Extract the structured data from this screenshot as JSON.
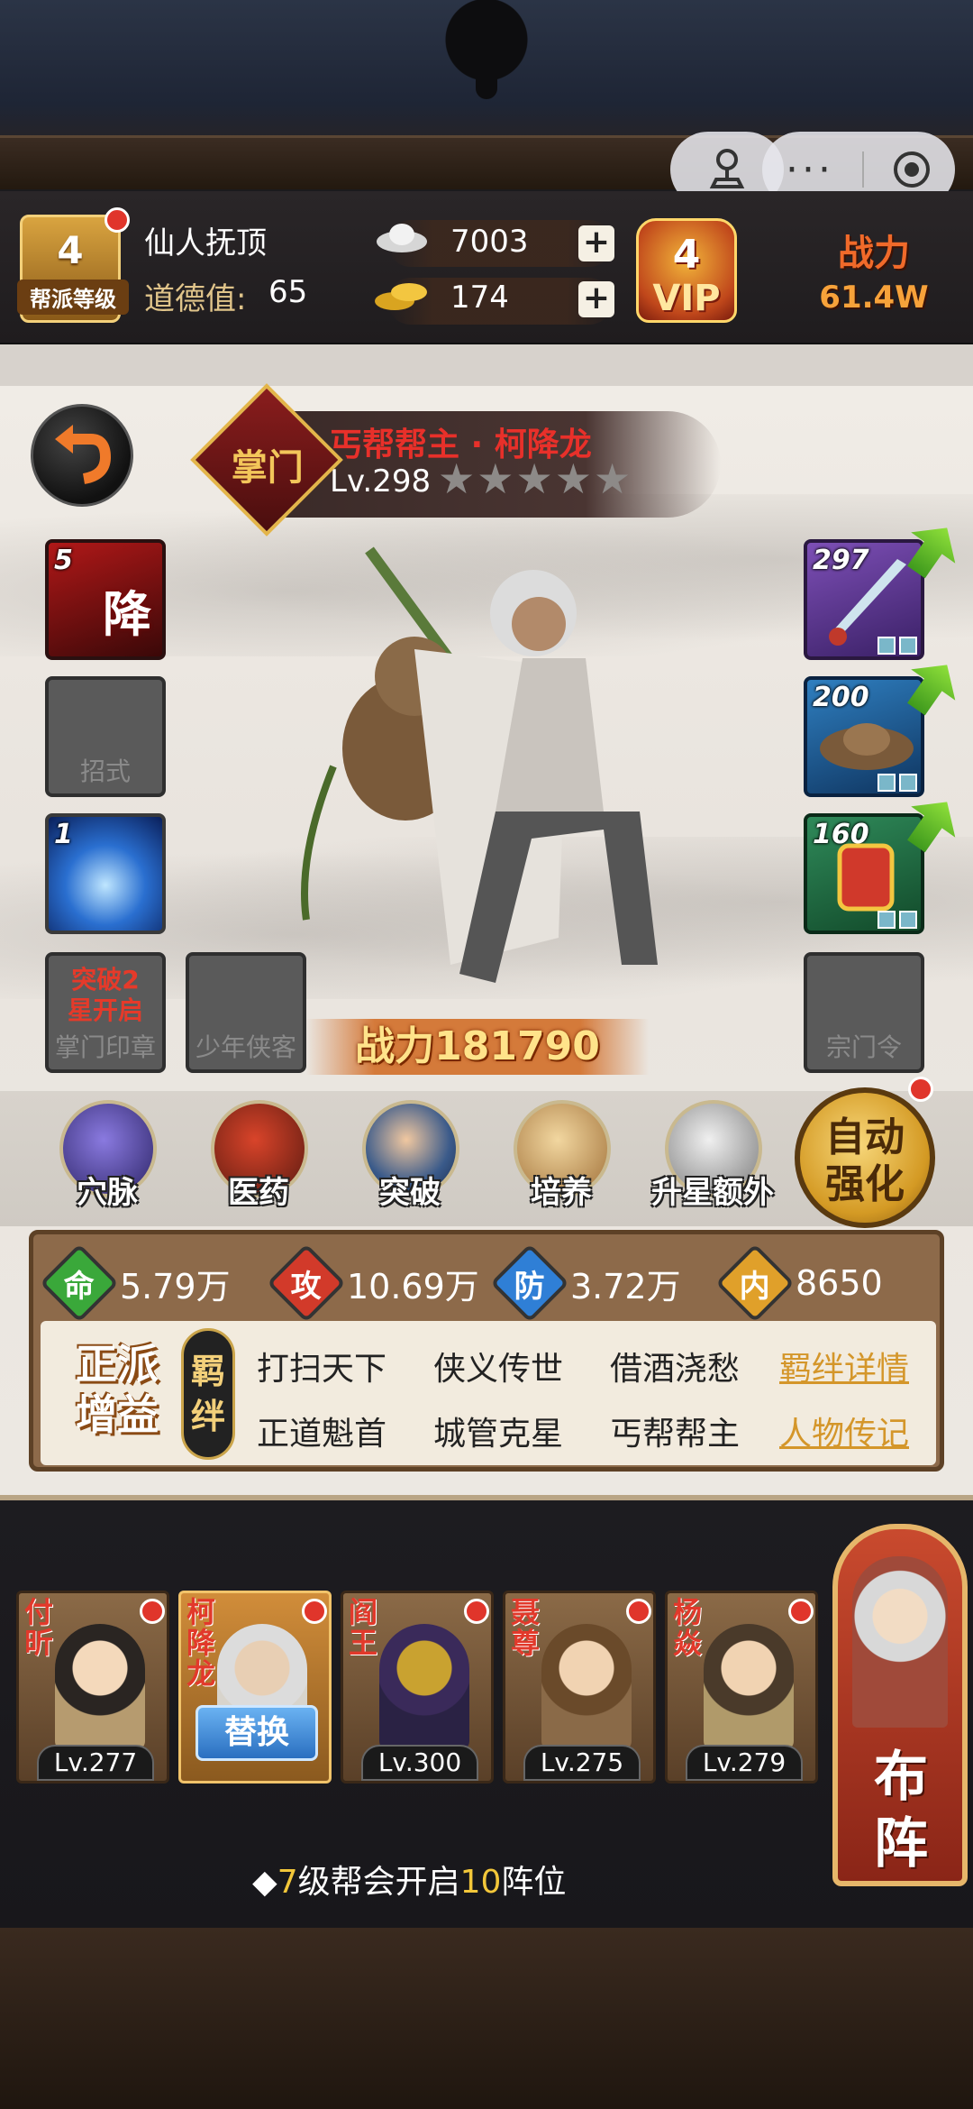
{
  "top": {
    "guild_level": "4",
    "guild_level_caption": "帮派等级",
    "player_name": "仙人抚顶",
    "morality_label": "道德值:",
    "morality_value": "65",
    "silver": "7003",
    "gold": "174",
    "vip_level": "4",
    "vip_text": "VIP",
    "power_label": "战力",
    "power_value": "61.4W",
    "menu_dots": "···"
  },
  "character": {
    "title": "丐帮帮主 · 柯降龙",
    "emblem": "掌门",
    "level": "Lv.298",
    "stars": 5,
    "power_text": "战力181790"
  },
  "left_slots": [
    {
      "num": "5",
      "glyph": "降",
      "label": ""
    },
    {
      "num": "",
      "glyph": "",
      "label": "招式"
    },
    {
      "num": "1",
      "glyph": "",
      "label": ""
    }
  ],
  "bottom_left_slots": [
    {
      "lock_text": "突破2\n星开启",
      "label": "掌门印章"
    },
    {
      "lock_text": "",
      "label": "少年侠客"
    }
  ],
  "right_slots": [
    {
      "num": "297"
    },
    {
      "num": "200"
    },
    {
      "num": "160"
    },
    {
      "label": "宗门令"
    }
  ],
  "skills": [
    {
      "label": "穴脉"
    },
    {
      "label": "医药"
    },
    {
      "label": "突破"
    },
    {
      "label": "培养"
    },
    {
      "label": "升星额外"
    }
  ],
  "auto_button": "自动\n强化",
  "stats": {
    "hp_icon": "命",
    "hp": "5.79万",
    "atk_icon": "攻",
    "atk": "10.69万",
    "def_icon": "防",
    "def": "3.72万",
    "inner_icon": "内",
    "inner": "8650"
  },
  "faction_bonus": "正派\n增益",
  "bond_tag": "羁\n绊",
  "bonds": [
    "打扫天下",
    "侠义传世",
    "借酒浇愁",
    "正道魁首",
    "城管克星",
    "丐帮帮主"
  ],
  "links": {
    "bond_detail": "羁绊详情",
    "biography": "人物传记"
  },
  "team": [
    {
      "name": "付昕",
      "level": "Lv.277"
    },
    {
      "name": "柯降龙",
      "level": "",
      "swap": "替换"
    },
    {
      "name": "阎王",
      "level": "Lv.300"
    },
    {
      "name": "聂尊",
      "level": "Lv.275"
    },
    {
      "name": "杨焱",
      "level": "Lv.279"
    }
  ],
  "formation_button": "布\n阵",
  "tip": {
    "prefix": "◆",
    "n1": "7",
    "mid": "级帮会开启",
    "n2": "10",
    "suffix": "阵位"
  },
  "colors": {
    "accent_gold": "#f3c73a",
    "stat_hp": "#3aa83a",
    "stat_atk": "#d23a2a",
    "stat_def": "#2f7fd6",
    "stat_inner": "#e0a02a"
  }
}
